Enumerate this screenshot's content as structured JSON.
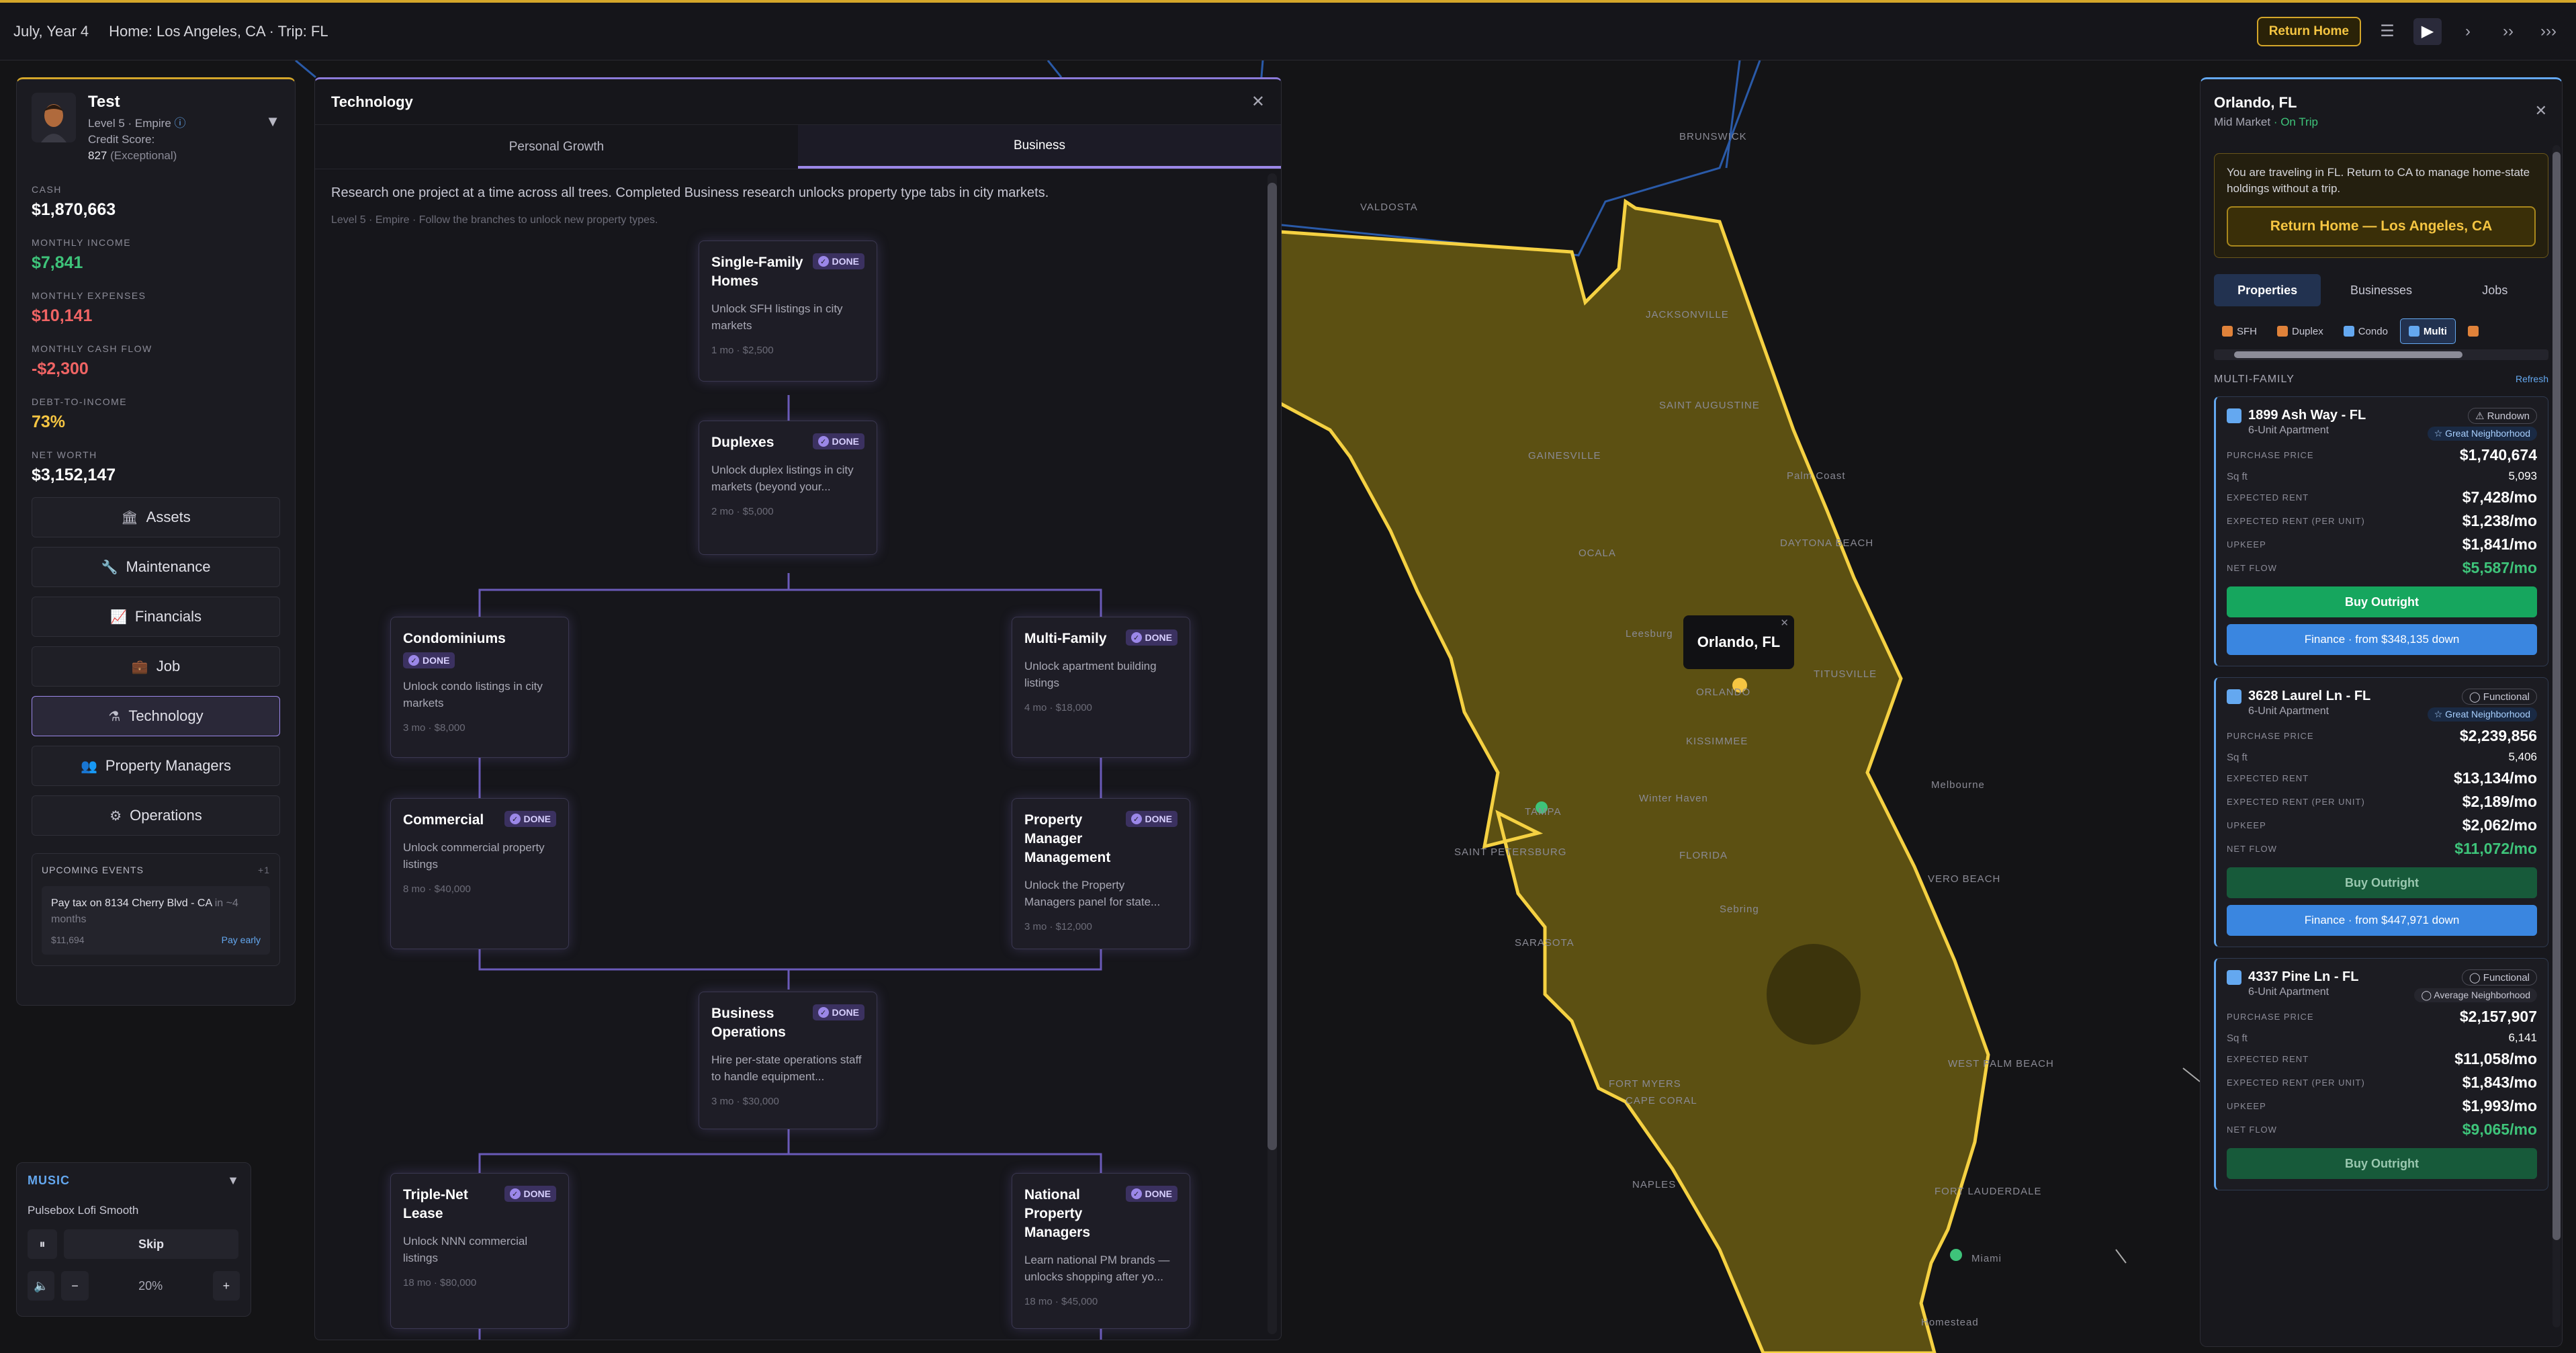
{
  "topbar": {
    "date": "July, Year 4",
    "location": "Home: Los Angeles, CA · Trip: FL",
    "return_home_label": "Return Home",
    "icons": [
      "menu-icon",
      "play-icon",
      "step-icon",
      "fast-icon",
      "fastest-icon"
    ],
    "accent": "#d4a62a"
  },
  "profile": {
    "name": "Test",
    "level": "Level 5 · Empire",
    "credit_label": "Credit Score:",
    "credit_value": "827",
    "credit_rating": "(Exceptional)"
  },
  "stats": [
    {
      "label": "Cash",
      "value": "$1,870,663",
      "color": "#ffffff"
    },
    {
      "label": "Monthly Income",
      "value": "$7,841",
      "color": "#3ec47a"
    },
    {
      "label": "Monthly Expenses",
      "value": "$10,141",
      "color": "#f06464"
    },
    {
      "label": "Monthly Cash Flow",
      "value": "-$2,300",
      "color": "#f06464"
    },
    {
      "label": "Debt-to-Income",
      "value": "73%",
      "color": "#f5c542"
    },
    {
      "label": "Net Worth",
      "value": "$3,152,147",
      "color": "#ffffff"
    }
  ],
  "nav": [
    {
      "label": "Assets",
      "icon": "bank-icon"
    },
    {
      "label": "Maintenance",
      "icon": "wrench-icon"
    },
    {
      "label": "Financials",
      "icon": "chart-icon"
    },
    {
      "label": "Job",
      "icon": "briefcase-icon"
    },
    {
      "label": "Technology",
      "icon": "flask-icon",
      "active": true
    },
    {
      "label": "Property Managers",
      "icon": "people-icon"
    },
    {
      "label": "Operations",
      "icon": "gear-icon"
    }
  ],
  "events": {
    "title": "UPCOMING EVENTS",
    "count": "+1",
    "item_text": "Pay tax on 8134 Cherry Blvd - CA",
    "item_when": "in ~4 months",
    "item_amount": "$11,694",
    "item_action": "Pay early"
  },
  "music": {
    "title": "MUSIC",
    "track": "Pulsebox Lofi Smooth",
    "skip_label": "Skip",
    "volume": "20%"
  },
  "tech": {
    "title": "Technology",
    "tabs": [
      "Personal Growth",
      "Business"
    ],
    "active_tab": 1,
    "description": "Research one project at a time across all trees. Completed Business research unlocks property type tabs in city markets.",
    "subtitle": "Level 5 · Empire · Follow the branches to unlock new property types.",
    "done_label": "DONE",
    "nodes": {
      "sfh": {
        "title": "Single-Family Homes",
        "desc": "Unlock SFH listings in city markets",
        "cost": "1 mo · $2,500"
      },
      "duplex": {
        "title": "Duplexes",
        "desc": "Unlock duplex listings in city markets (beyond your...",
        "cost": "2 mo · $5,000"
      },
      "condo": {
        "title": "Condominiums",
        "desc": "Unlock condo listings in city markets",
        "cost": "3 mo · $8,000"
      },
      "multi": {
        "title": "Multi-Family",
        "desc": "Unlock apartment building listings",
        "cost": "4 mo · $18,000"
      },
      "commercial": {
        "title": "Commercial",
        "desc": "Unlock commercial property listings",
        "cost": "8 mo · $40,000"
      },
      "pmm": {
        "title": "Property Manager Management",
        "desc": "Unlock the Property Managers panel for state...",
        "cost": "3 mo · $12,000"
      },
      "bizops": {
        "title": "Business Operations",
        "desc": "Hire per-state operations staff to handle equipment...",
        "cost": "3 mo · $30,000"
      },
      "nnn": {
        "title": "Triple-Net Lease",
        "desc": "Unlock NNN commercial listings",
        "cost": "18 mo · $80,000"
      },
      "npm": {
        "title": "National Property Managers",
        "desc": "Learn national PM brands — unlocks shopping after yo...",
        "cost": "18 mo · $45,000"
      }
    }
  },
  "map": {
    "labels": [
      "VALDOSTA",
      "BRUNSWICK",
      "JACKSONVILLE",
      "SAINT AUGUSTINE",
      "GAINESVILLE",
      "Palm Coast",
      "OCALA",
      "DAYTONA BEACH",
      "TITUSVILLE",
      "Leesburg",
      "ORLANDO",
      "KISSIMMEE",
      "Winter Haven",
      "TAMPA",
      "SAINT PETERSBURG",
      "FLORIDA",
      "Sebring",
      "VERO BEACH",
      "SARASOTA",
      "WEST PALM BEACH",
      "FORT MYERS",
      "CAPE CORAL",
      "NAPLES",
      "FORT LAUDERDALE",
      "Miami",
      "Homestead",
      "Melbourne"
    ],
    "tooltip": "Orlando, FL",
    "highlight_color": "#f5d142"
  },
  "city": {
    "title": "Orlando, FL",
    "market": "Mid Market",
    "trip": "· On Trip",
    "notice": "You are traveling in FL. Return to CA to manage home-state holdings without a trip.",
    "return_btn": "Return Home — Los Angeles, CA",
    "tabs": [
      "Properties",
      "Businesses",
      "Jobs"
    ],
    "ptypes": [
      "SFH",
      "Duplex",
      "Condo",
      "Multi"
    ],
    "section": "MULTI-FAMILY",
    "refresh": "Refresh",
    "labels": {
      "purchase": "Purchase Price",
      "sqft": "Sq ft",
      "rent": "Expected Rent",
      "rent_unit": "Expected Rent (per unit)",
      "upkeep": "Upkeep",
      "net": "Net Flow",
      "buy": "Buy Outright"
    },
    "listings": [
      {
        "addr": "1899 Ash Way - FL",
        "type": "6-Unit Apartment",
        "condition": "⚠ Rundown",
        "neighborhood": "☆ Great Neighborhood",
        "price": "$1,740,674",
        "sqft": "5,093",
        "rent": "$7,428/mo",
        "rent_unit": "$1,238/mo",
        "upkeep": "$1,841/mo",
        "net": "$5,587/mo",
        "finance": "Finance · from $348,135 down"
      },
      {
        "addr": "3628 Laurel Ln - FL",
        "type": "6-Unit Apartment",
        "condition": "◯ Functional",
        "neighborhood": "☆ Great Neighborhood",
        "price": "$2,239,856",
        "sqft": "5,406",
        "rent": "$13,134/mo",
        "rent_unit": "$2,189/mo",
        "upkeep": "$2,062/mo",
        "net": "$11,072/mo",
        "finance": "Finance · from $447,971 down"
      },
      {
        "addr": "4337 Pine Ln - FL",
        "type": "6-Unit Apartment",
        "condition": "◯ Functional",
        "neighborhood": "◯ Average Neighborhood",
        "price": "$2,157,907",
        "sqft": "6,141",
        "rent": "$11,058/mo",
        "rent_unit": "$1,843/mo",
        "upkeep": "$1,993/mo",
        "net": "$9,065/mo",
        "finance": ""
      }
    ]
  }
}
